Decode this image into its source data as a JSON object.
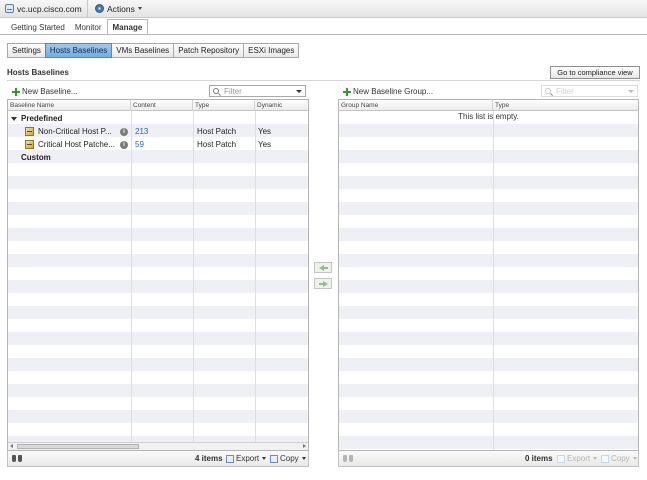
{
  "topbar": {
    "host": "vc.ucp.cisco.com",
    "actions_label": "Actions"
  },
  "main_tabs": [
    {
      "label": "Getting Started",
      "active": false
    },
    {
      "label": "Monitor",
      "active": false
    },
    {
      "label": "Manage",
      "active": true
    }
  ],
  "sub_tabs": [
    {
      "label": "Settings",
      "active": false
    },
    {
      "label": "Hosts Baselines",
      "active": true
    },
    {
      "label": "VMs Baselines",
      "active": false
    },
    {
      "label": "Patch Repository",
      "active": false
    },
    {
      "label": "ESXi Images",
      "active": false
    }
  ],
  "section_title": "Hosts Baselines",
  "compliance_button": "Go to compliance view",
  "left_panel": {
    "new_label": "New Baseline...",
    "filter_placeholder": "Filter",
    "columns": [
      "Baseline Name",
      "Content",
      "Type",
      "Dynamic"
    ],
    "groups": [
      {
        "label": "Predefined",
        "rows": [
          {
            "name": "Non-Critical Host P...",
            "content": "213",
            "type": "Host Patch",
            "dynamic": "Yes"
          },
          {
            "name": "Critical Host Patche...",
            "content": "59",
            "type": "Host Patch",
            "dynamic": "Yes"
          }
        ]
      },
      {
        "label": "Custom",
        "rows": []
      }
    ],
    "footer": {
      "count": "4 items",
      "export": "Export",
      "copy": "Copy"
    }
  },
  "right_panel": {
    "new_label": "New Baseline Group...",
    "filter_placeholder": "Filter",
    "columns": [
      "Group Name",
      "Type"
    ],
    "empty_message": "This list is empty.",
    "footer": {
      "count": "0 items",
      "export": "Export",
      "copy": "Copy"
    }
  },
  "colors": {
    "accent_tab": "#73aee0",
    "link": "#2a6ab0",
    "add_green": "#2f9b2f"
  }
}
